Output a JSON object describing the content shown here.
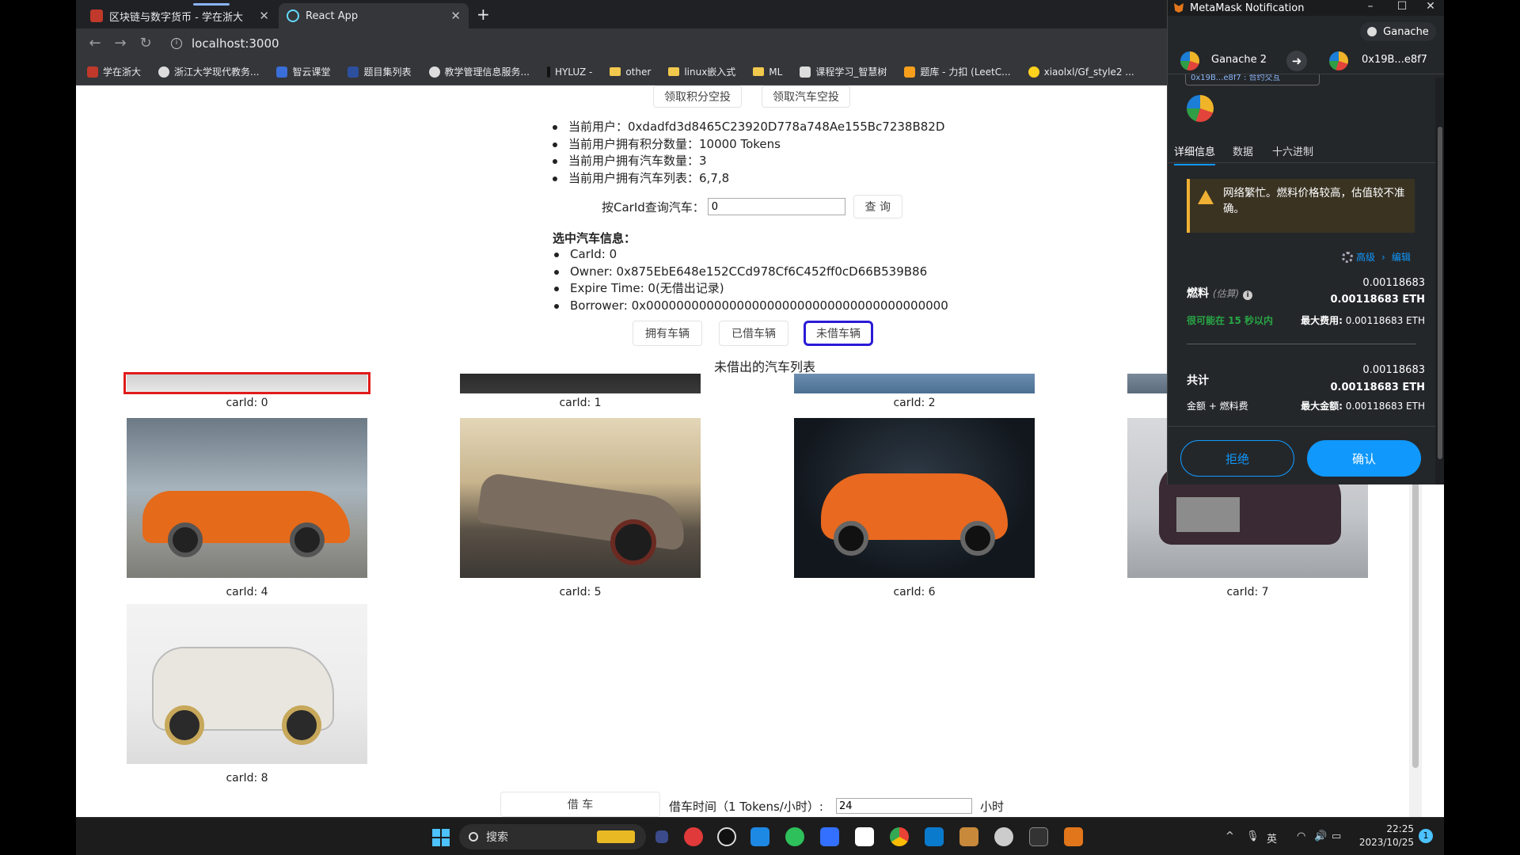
{
  "browser": {
    "tabs": [
      {
        "title": "区块链与数字货币 - 学在浙大",
        "active": false
      },
      {
        "title": "React App",
        "active": true
      }
    ],
    "url": "localhost:3000",
    "bookmarks": [
      "学在浙大",
      "浙江大学现代教务...",
      "智云课堂",
      "题目集列表",
      "教学管理信息服务...",
      "HYLUZ -",
      "other",
      "linux嵌入式",
      "ML",
      "课程学习_智慧树",
      "题库 - 力扣 (LeetC...",
      "xiaolxl/Gf_style2 ..."
    ]
  },
  "app": {
    "airdrop_points": "领取积分空投",
    "airdrop_car": "领取汽车空投",
    "user_info": [
      "当前用户：0xdadfd3d8465C23920D778a748Ae155Bc7238B82D",
      "当前用户拥有积分数量：10000 Tokens",
      "当前用户拥有汽车数量：3",
      "当前用户拥有汽车列表：6,7,8"
    ],
    "query_label": "按CarId查询汽车：",
    "query_value": "0",
    "query_button": "查 询",
    "selected_title": "选中汽车信息：",
    "selected_info": [
      "CarId: 0",
      "Owner: 0x875EbE648e152CCd978Cf6C452ff0cD66B539B86",
      "Expire Time: 0(无借出记录)",
      "Borrower: 0x0000000000000000000000000000000000000000"
    ],
    "filters": [
      "拥有车辆",
      "已借车辆",
      "未借车辆"
    ],
    "active_filter": "未借车辆",
    "list_title": "未借出的汽车列表",
    "cars_top_row": [
      "carId: 0",
      "carId: 1",
      "carId: 2"
    ],
    "cars": [
      "carId: 4",
      "carId: 5",
      "carId: 6",
      "carId: 7",
      "carId: 8"
    ],
    "borrow_button": "借 车",
    "borrow_label": "借车时间（1 Tokens/小时）:",
    "borrow_hours": "24",
    "hour_unit": "小时"
  },
  "metamask": {
    "window_title": "MetaMask Notification",
    "network": "Ganache",
    "from_account": "Ganache 2",
    "to_account": "0x19B...e8f7",
    "origin": "0x19B...e8f7 : 合约交互",
    "tabs": [
      "详细信息",
      "数据",
      "十六进制"
    ],
    "warning": "网络繁忙。燃料价格较高，估值较不准确。",
    "advanced": "高级",
    "edit": "编辑",
    "gas_label": "燃料",
    "gas_estimated": "(估算)",
    "gas_amount": "0.00118683",
    "gas_amount_eth": "0.00118683 ETH",
    "gas_time": "很可能在 15 秒以内",
    "max_fee_label": "最大费用:",
    "max_fee": "0.00118683 ETH",
    "total_label": "共计",
    "total_amount": "0.00118683",
    "total_amount_eth": "0.00118683 ETH",
    "total_sub": "金额 + 燃料费",
    "max_total_label": "最大金额:",
    "max_total": "0.00118683 ETH",
    "reject": "拒绝",
    "confirm": "确认"
  },
  "taskbar": {
    "search": "搜索",
    "lang": "英",
    "time": "22:25",
    "date": "2023/10/25",
    "badge": "1"
  }
}
